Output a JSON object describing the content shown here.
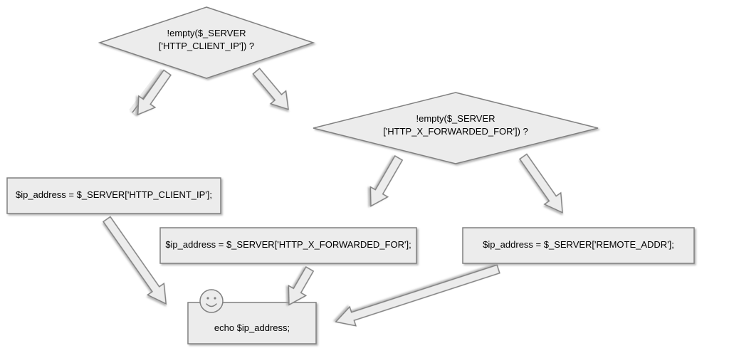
{
  "diagram": {
    "decision1": {
      "line1": "!empty($_SERVER",
      "line2": "['HTTP_CLIENT_IP']) ?"
    },
    "decision2": {
      "line1": "!empty($_SERVER",
      "line2": "['HTTP_X_FORWARDED_FOR']) ?"
    },
    "box1": "$ip_address = $_SERVER['HTTP_CLIENT_IP'];",
    "box2": "$ip_address = $_SERVER['HTTP_X_FORWARDED_FOR'];",
    "box3": "$ip_address = $_SERVER['REMOTE_ADDR'];",
    "box4": "echo $ip_address;"
  },
  "colors": {
    "fill": "#ececec",
    "stroke": "#808080"
  }
}
